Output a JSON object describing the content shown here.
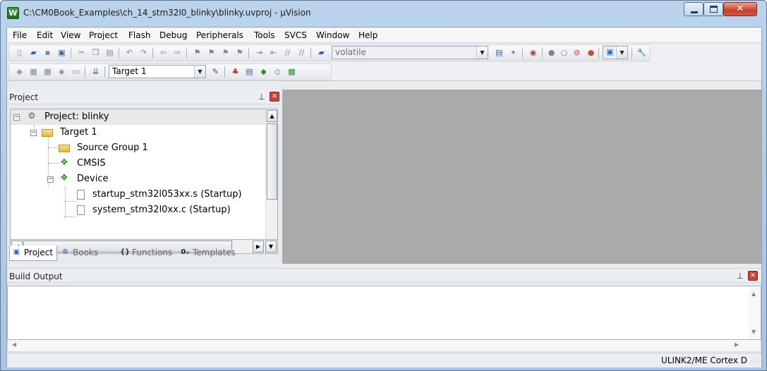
{
  "window": {
    "title": "C:\\CM0Book_Examples\\ch_14_stm32l0_blinky\\blinky.uvproj - µVision",
    "app_icon_letter": "W"
  },
  "menu": [
    "File",
    "Edit",
    "View",
    "Project",
    "Flash",
    "Debug",
    "Peripherals",
    "Tools",
    "SVCS",
    "Window",
    "Help"
  ],
  "toolbar": {
    "find_combo_value": "volatile",
    "target_combo_value": "Target 1"
  },
  "project_panel": {
    "title": "Project",
    "tree": {
      "project_label": "Project: blinky",
      "target_label": "Target 1",
      "source_group_label": "Source Group 1",
      "cmsis_label": "CMSIS",
      "device_label": "Device",
      "startup_file_label": "startup_stm32l053xx.s (Startup)",
      "system_file_label": "system_stm32l0xx.c (Startup)"
    },
    "tabs": {
      "project": "Project",
      "books": "Books",
      "functions": "Functions",
      "templates": "Templates"
    }
  },
  "build_output": {
    "title": "Build Output"
  },
  "status_bar": {
    "debugger": "ULINK2/ME Cortex D"
  },
  "colors": {
    "editor_background": "#aaaaaa",
    "title_bar": "#bcd3ec",
    "close_button": "#c6402a"
  }
}
